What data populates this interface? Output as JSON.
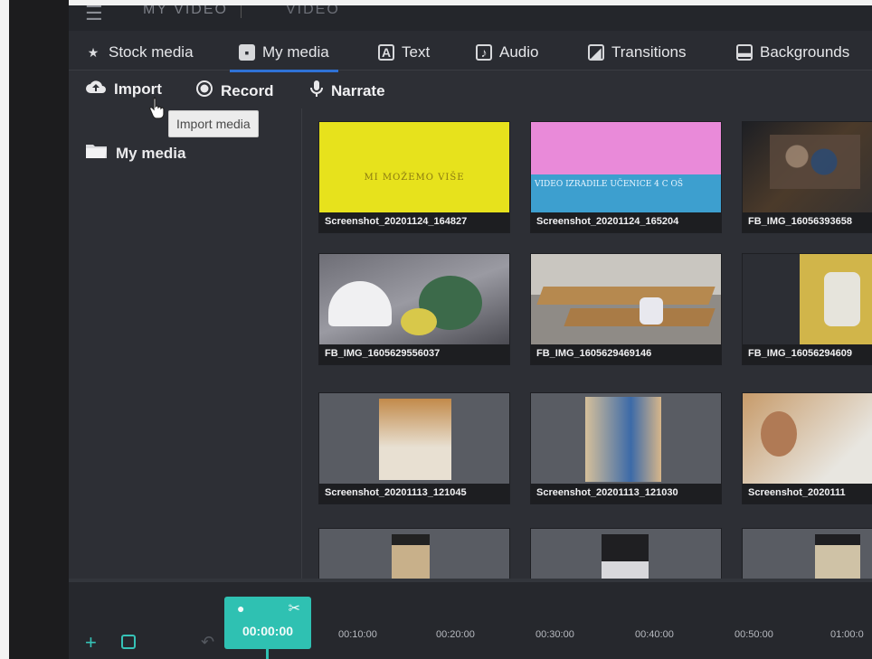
{
  "titlebar": {
    "title": "MY VIDEO",
    "title2": "VIDEO"
  },
  "tabs": [
    {
      "label": "Stock media",
      "icon": "star-icon"
    },
    {
      "label": "My media",
      "icon": "folder-add-icon",
      "active": true
    },
    {
      "label": "Text",
      "icon": "text-icon"
    },
    {
      "label": "Audio",
      "icon": "music-icon"
    },
    {
      "label": "Transitions",
      "icon": "transition-icon"
    },
    {
      "label": "Backgrounds",
      "icon": "background-icon"
    }
  ],
  "actions": {
    "import": "Import",
    "record": "Record",
    "narrate": "Narrate",
    "tooltip": "Import media"
  },
  "folder": {
    "label": "My media"
  },
  "media": [
    {
      "name": "Screenshot_20201124_164827",
      "thumb_text": "MI MOŽEMO VIŠE"
    },
    {
      "name": "Screenshot_20201124_165204",
      "thumb_text": "VIDEO IZRADILE UČENICE 4 C OŠ"
    },
    {
      "name": "FB_IMG_16056393658"
    },
    {
      "name": "FB_IMG_1605629556037"
    },
    {
      "name": "FB_IMG_1605629469146"
    },
    {
      "name": "FB_IMG_16056294609"
    },
    {
      "name": "Screenshot_20201113_121045"
    },
    {
      "name": "Screenshot_20201113_121030"
    },
    {
      "name": "Screenshot_2020111"
    },
    {
      "name": ""
    },
    {
      "name": ""
    },
    {
      "name": ""
    }
  ],
  "timeline": {
    "current": "00:00:00",
    "ticks": [
      "00:10:00",
      "00:20:00",
      "00:30:00",
      "00:40:00",
      "00:50:00",
      "01:00:0"
    ]
  },
  "colors": {
    "accent": "#2f72d6",
    "teal": "#2fc1b2"
  }
}
